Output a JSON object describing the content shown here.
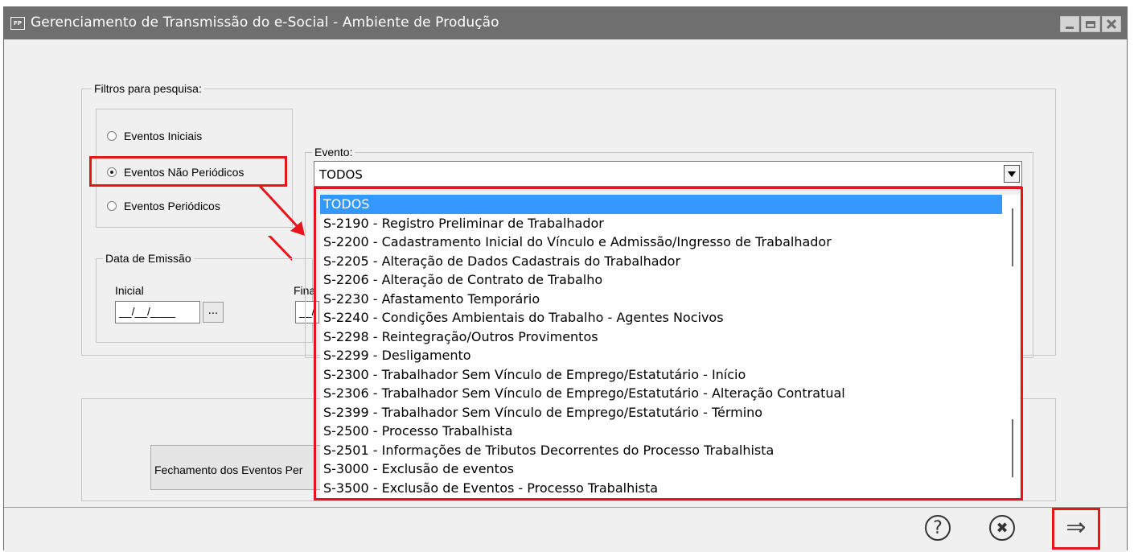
{
  "window": {
    "title": "Gerenciamento de Transmissão do e-Social - Ambiente de Produção",
    "icon_label": "FP",
    "controls": [
      "minimize-icon",
      "maximize-icon",
      "close-icon"
    ]
  },
  "filters": {
    "group_label": "Filtros para pesquisa:",
    "radios": [
      {
        "label": "Eventos Iniciais",
        "checked": false
      },
      {
        "label": "Eventos Não Periódicos",
        "checked": true
      },
      {
        "label": "Eventos Periódicos",
        "checked": false
      }
    ]
  },
  "evento": {
    "group_label": "Evento:",
    "selected": "TODOS",
    "options": [
      "TODOS",
      "S-2190 - Registro Preliminar de Trabalhador",
      "S-2200 - Cadastramento Inicial do Vínculo e Admissão/Ingresso de Trabalhador",
      "S-2205 - Alteração de Dados Cadastrais do Trabalhador",
      "S-2206 - Alteração de Contrato de Trabalho",
      "S-2230 - Afastamento Temporário",
      "S-2240 - Condições Ambientais do Trabalho - Agentes Nocivos",
      "S-2298 - Reintegração/Outros Provimentos",
      "S-2299 - Desligamento",
      "S-2300 - Trabalhador Sem Vínculo de Emprego/Estatutário - Início",
      "S-2306 - Trabalhador Sem Vínculo de Emprego/Estatutário - Alteração Contratual",
      "S-2399 - Trabalhador Sem Vínculo de Emprego/Estatutário - Término",
      "S-2500 - Processo Trabalhista",
      "S-2501 - Informações de Tributos Decorrentes do Processo Trabalhista",
      "S-3000 - Exclusão de eventos",
      "S-3500 - Exclusão de Eventos - Processo Trabalhista"
    ]
  },
  "data_emissao": {
    "group_label": "Data de Emissão",
    "inicial_label": "Inicial",
    "inicial_value": "__/__/____",
    "final_label": "Fina",
    "final_value": "__/",
    "browse_label": "..."
  },
  "buttons": {
    "fechamento_label": "Fechamento dos Eventos Per"
  },
  "bottom": {
    "icons": [
      "help-icon",
      "cancel-icon",
      "next-arrow-icon"
    ],
    "help_glyph": "?",
    "cancel_glyph": "✖",
    "next_glyph": "⇒"
  },
  "colors": {
    "highlight_red": "#e8141c",
    "selection_blue": "#3399ff",
    "titlebar_gray": "#6f6f6f"
  }
}
